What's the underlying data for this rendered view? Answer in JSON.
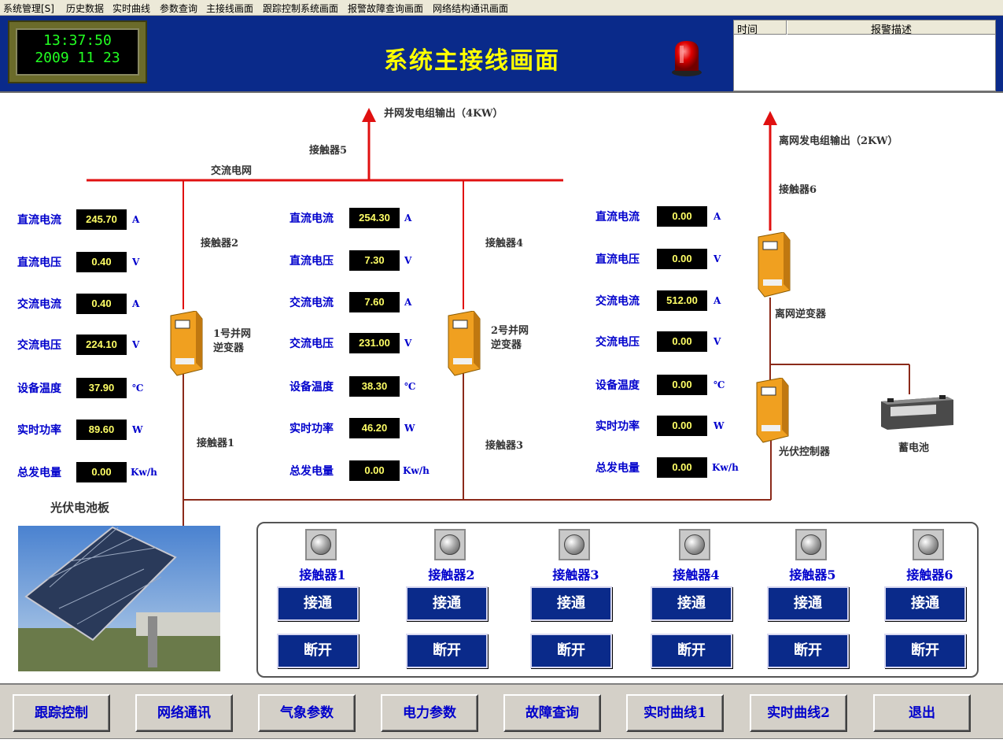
{
  "menu": [
    "系统管理[S]",
    "历史数据",
    "实时曲线",
    "参数查询",
    "主接线画面",
    "跟踪控制系统画面",
    "报警故障查询画面",
    "网络结构通讯画面"
  ],
  "clock": {
    "time": "13:37:50",
    "date": "2009 11 23"
  },
  "title": "系统主接线画面",
  "alarm": {
    "col_time": "时间",
    "col_desc": "报警描述"
  },
  "diagram": {
    "grid_output": "并网发电组输出（4KW）",
    "offgrid_output": "离网发电组输出（2KW）",
    "ac_grid": "交流电网",
    "contactor1": "接触器1",
    "contactor2": "接触器2",
    "contactor3": "接触器3",
    "contactor4": "接触器4",
    "contactor5": "接触器5",
    "contactor6": "接触器6",
    "inverter1": "1号并网\n逆变器",
    "inverter1_l1": "1号并网",
    "inverter1_l2": "逆变器",
    "inverter2_l1": "2号并网",
    "inverter2_l2": "逆变器",
    "offgrid_inverter": "离网逆变器",
    "pv_controller": "光伏控制器",
    "battery": "蓄电池",
    "pv_panel": "光伏电池板"
  },
  "param_labels": [
    "直流电流",
    "直流电压",
    "交流电流",
    "交流电压",
    "设备温度",
    "实时功率",
    "总发电量"
  ],
  "units": [
    "A",
    "V",
    "A",
    "V",
    "℃",
    "W",
    "Kw/h"
  ],
  "group1": [
    "245.70",
    "0.40",
    "0.40",
    "224.10",
    "37.90",
    "89.60",
    "0.00"
  ],
  "group2": [
    "254.30",
    "7.30",
    "7.60",
    "231.00",
    "38.30",
    "46.20",
    "0.00"
  ],
  "group3": [
    "0.00",
    "0.00",
    "512.00",
    "0.00",
    "0.00",
    "0.00",
    "0.00"
  ],
  "contactors": [
    {
      "label": "接触器1",
      "on": "接通",
      "off": "断开"
    },
    {
      "label": "接触器2",
      "on": "接通",
      "off": "断开"
    },
    {
      "label": "接触器3",
      "on": "接通",
      "off": "断开"
    },
    {
      "label": "接触器4",
      "on": "接通",
      "off": "断开"
    },
    {
      "label": "接触器5",
      "on": "接通",
      "off": "断开"
    },
    {
      "label": "接触器6",
      "on": "接通",
      "off": "断开"
    }
  ],
  "nav": [
    "跟踪控制",
    "网络通讯",
    "气象参数",
    "电力参数",
    "故障查询",
    "实时曲线1",
    "实时曲线2",
    "退出"
  ],
  "colors": {
    "header_bg": "#0a2a8a",
    "title": "#ffff00",
    "clock_text": "#22ff22",
    "value_text": "#ffff66",
    "label_blue": "#0000cc",
    "line_red": "#e01010",
    "line_brown": "#8b2a1a"
  }
}
